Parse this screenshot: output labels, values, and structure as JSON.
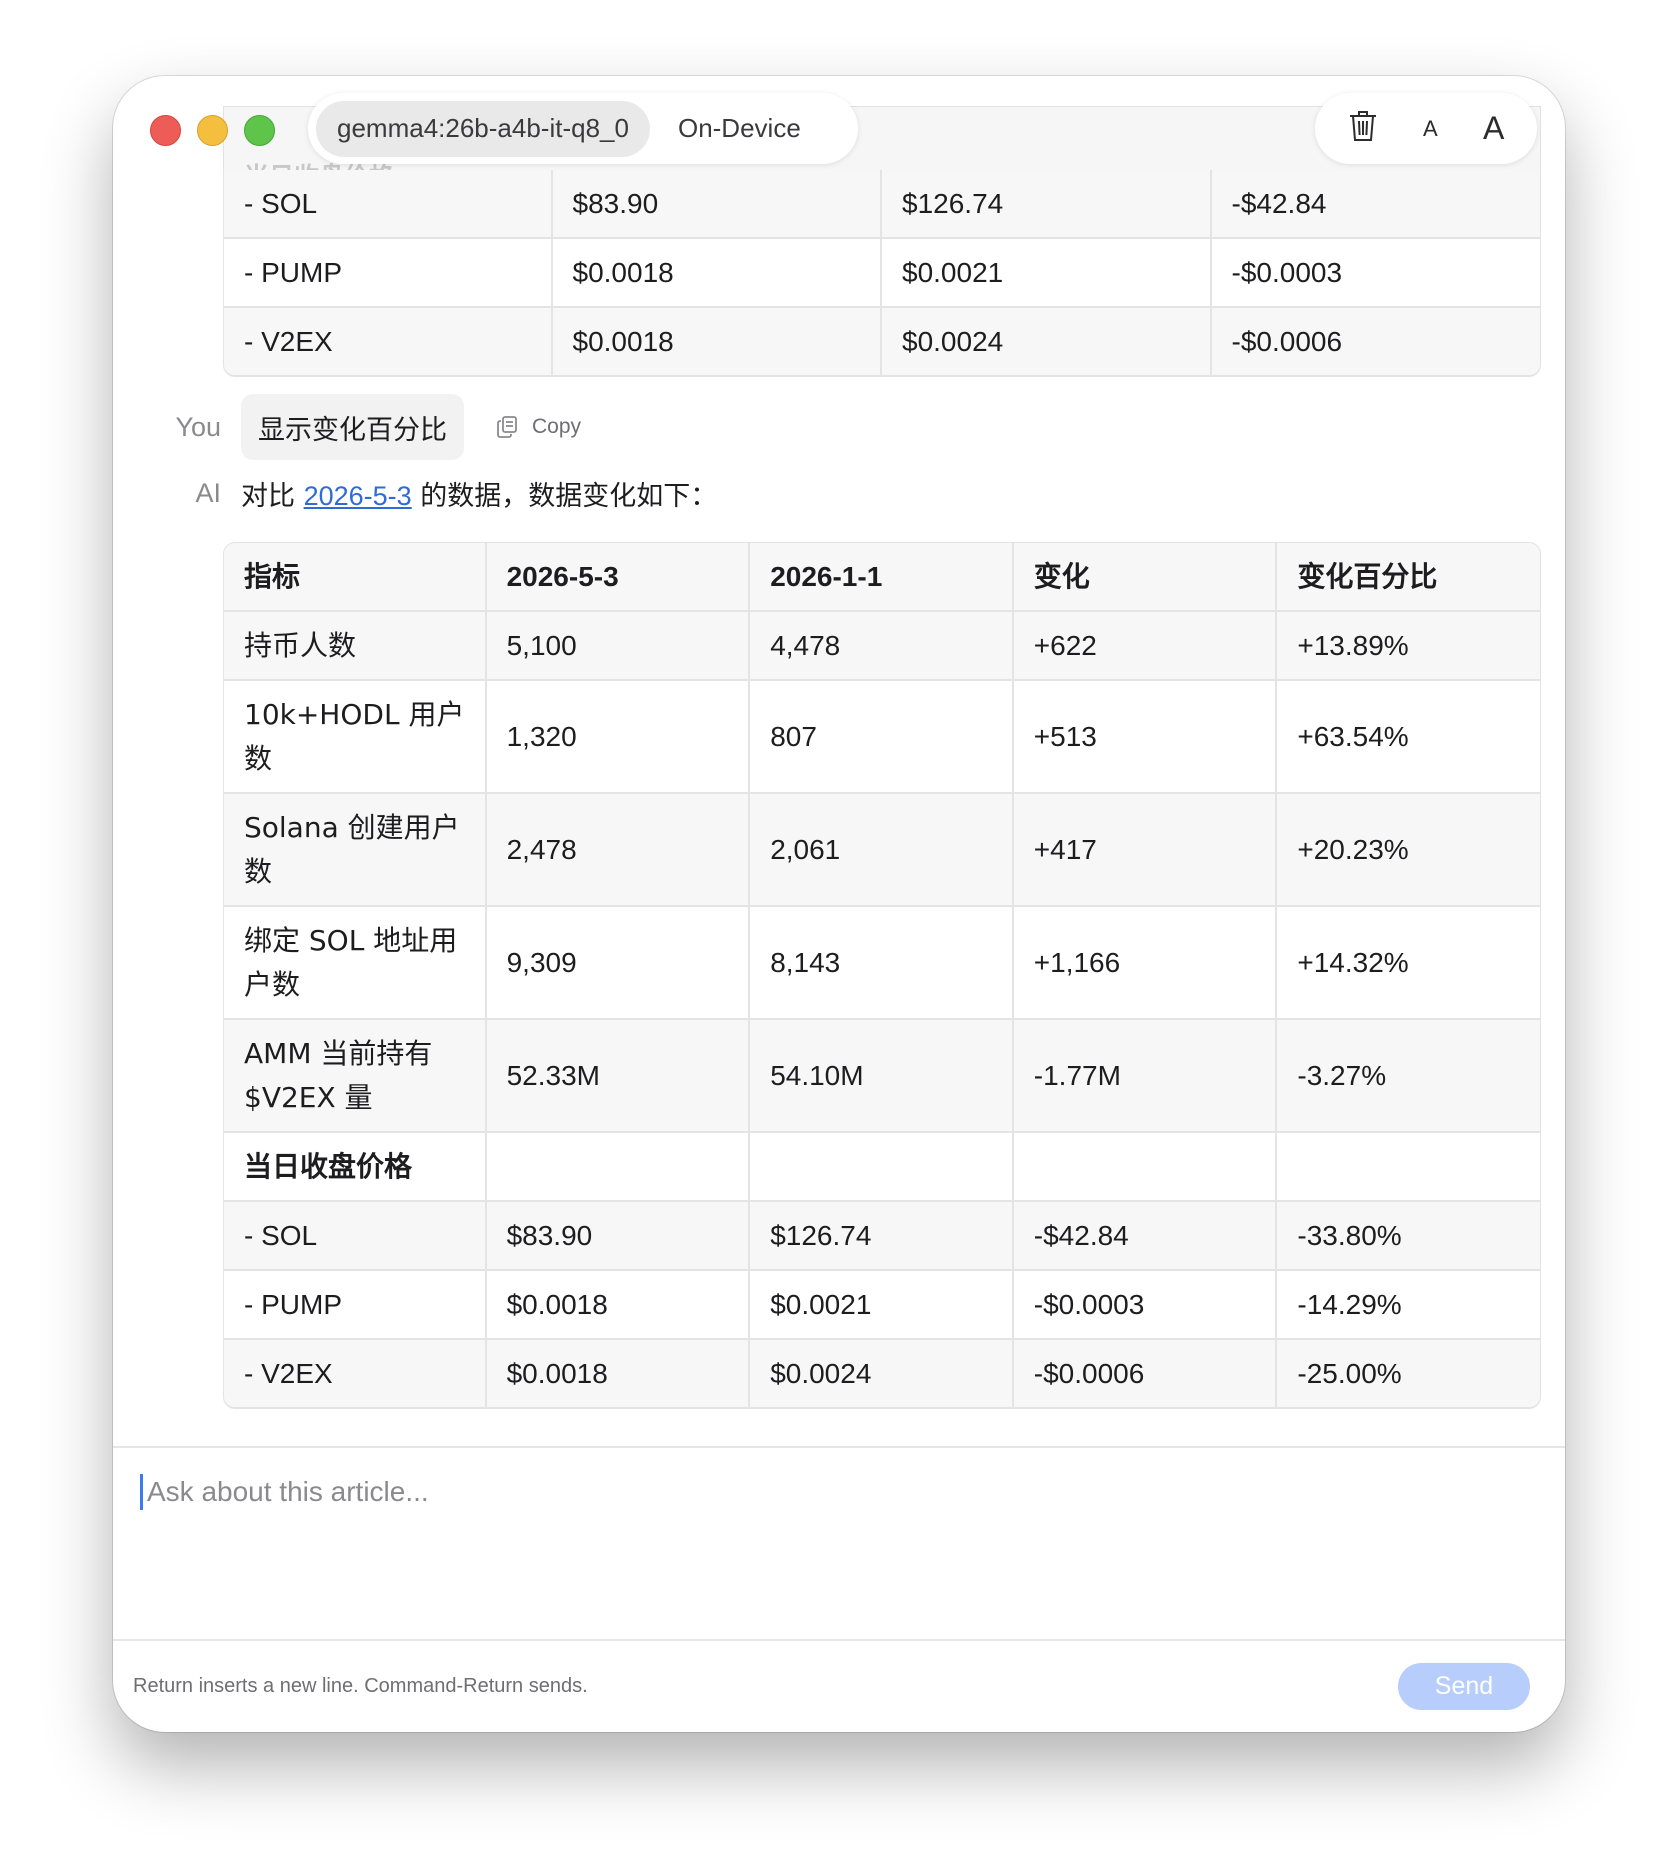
{
  "toolbar": {
    "model_name": "gemma4:26b-a4b-it-q8_0",
    "location": "On-Device",
    "font_small_label": "A",
    "font_large_label": "A",
    "ghost_text": "当日收盘价格"
  },
  "previous_table": {
    "rows": [
      [
        "- SOL",
        "$83.90",
        "$126.74",
        "-$42.84"
      ],
      [
        "- PUMP",
        "$0.0018",
        "$0.0021",
        "-$0.0003"
      ],
      [
        "- V2EX",
        "$0.0018",
        "$0.0024",
        "-$0.0006"
      ]
    ]
  },
  "user_message": {
    "role": "You",
    "text": "显示变化百分比",
    "copy_label": "Copy"
  },
  "ai_message": {
    "role": "AI",
    "intro_before": "对比 ",
    "link_text": "2026-5-3",
    "intro_after": " 的数据，数据变化如下："
  },
  "main_table": {
    "headers": [
      "指标",
      "2026-5-3",
      "2026-1-1",
      "变化",
      "变化百分比"
    ],
    "rows": [
      [
        "持币人数",
        "5,100",
        "4,478",
        "+622",
        "+13.89%"
      ],
      [
        "10k+HODL 用户数",
        "1,320",
        "807",
        "+513",
        "+63.54%"
      ],
      [
        "Solana 创建用户数",
        "2,478",
        "2,061",
        "+417",
        "+20.23%"
      ],
      [
        "绑定 SOL 地址用户数",
        "9,309",
        "8,143",
        "+1,166",
        "+14.32%"
      ],
      [
        "AMM 当前持有 $V2EX 量",
        "52.33M",
        "54.10M",
        "-1.77M",
        "-3.27%"
      ],
      [
        "当日收盘价格",
        "",
        "",
        "",
        ""
      ],
      [
        "- SOL",
        "$83.90",
        "$126.74",
        "-$42.84",
        "-33.80%"
      ],
      [
        "- PUMP",
        "$0.0018",
        "$0.0021",
        "-$0.0003",
        "-14.29%"
      ],
      [
        "- V2EX",
        "$0.0018",
        "$0.0024",
        "-$0.0006",
        "-25.00%"
      ]
    ]
  },
  "input": {
    "placeholder": "Ask about this article...",
    "value": ""
  },
  "footer": {
    "hint": "Return inserts a new line. Command-Return sends.",
    "send_label": "Send"
  },
  "colors": {
    "link": "#2f6bd8",
    "send_disabled": "#b7cdfb",
    "caret": "#3b7bf0",
    "close": "#ee5c57",
    "minimize": "#f4be3e",
    "zoom": "#5ec54a"
  }
}
